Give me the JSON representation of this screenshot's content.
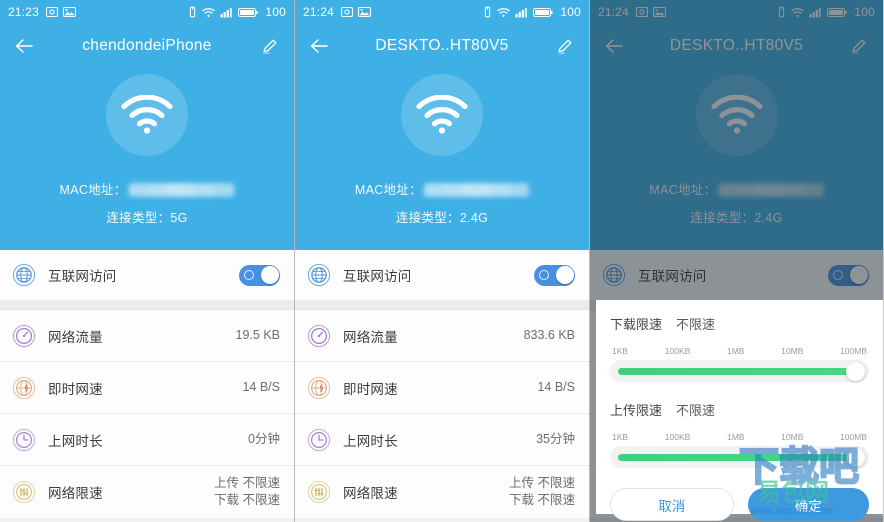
{
  "colors": {
    "accent_blue": "#35a5dd",
    "header_blue_light": "#3fb0e5",
    "panel3_dim": "#2b5063",
    "toggle_on": "#4a90e2",
    "slider_green": "#3fd07e",
    "ok_button": "#3d9ae0",
    "cancel_text": "#3f96e8"
  },
  "panels": [
    {
      "id": "panel-iphone",
      "statusbar": {
        "time": "21:23",
        "left_icons": [
          "screenshot-icon",
          "gallery-icon"
        ],
        "right_icons": [
          "vibrate-icon",
          "wifi-icon",
          "signal-icon",
          "battery-icon"
        ],
        "battery_text": "100"
      },
      "appbar": {
        "back_icon": "arrow-left-icon",
        "title": "chendondeiPhone",
        "edit_icon": "pencil-icon"
      },
      "hero": {
        "wifi_icon": "wifi-icon",
        "mac_label": "MAC地址：",
        "mac_value": "6c:21:A4:3c:40:14",
        "mac_redacted": true,
        "conn_label": "连接类型：",
        "conn_value": "5G"
      },
      "toggle_row": {
        "icon": "globe-icon",
        "label": "互联网访问",
        "state": "on"
      },
      "rows": [
        {
          "icon": "gauge-icon",
          "label": "网络流量",
          "value": "19.5 KB"
        },
        {
          "icon": "speed-icon",
          "label": "即时网速",
          "value": "14 B/S"
        },
        {
          "icon": "clock-icon",
          "label": "上网时长",
          "value": "0分钟"
        },
        {
          "icon": "limit-icon",
          "label": "网络限速",
          "value": "上传 不限速\n下载 不限速"
        }
      ]
    },
    {
      "id": "panel-desktop",
      "statusbar": {
        "time": "21:24",
        "left_icons": [
          "screenshot-icon",
          "gallery-icon"
        ],
        "right_icons": [
          "vibrate-icon",
          "wifi-icon",
          "signal-icon",
          "battery-icon"
        ],
        "battery_text": "100"
      },
      "appbar": {
        "back_icon": "arrow-left-icon",
        "title": "DESKTO..HT80V5",
        "edit_icon": "pencil-icon"
      },
      "hero": {
        "wifi_icon": "wifi-icon",
        "mac_label": "MAC地址：",
        "mac_value": "a8:5e:45:2b:99:c1",
        "mac_redacted": true,
        "conn_label": "连接类型：",
        "conn_value": "2.4G"
      },
      "toggle_row": {
        "icon": "globe-icon",
        "label": "互联网访问",
        "state": "on"
      },
      "rows": [
        {
          "icon": "gauge-icon",
          "label": "网络流量",
          "value": "833.6 KB"
        },
        {
          "icon": "speed-icon",
          "label": "即时网速",
          "value": "14 B/S"
        },
        {
          "icon": "clock-icon",
          "label": "上网时长",
          "value": "35分钟"
        },
        {
          "icon": "limit-icon",
          "label": "网络限速",
          "value": "上传 不限速\n下载 不限速"
        }
      ]
    },
    {
      "id": "panel-dialog",
      "dimmed": true,
      "statusbar": {
        "time": "21:24",
        "left_icons": [
          "screenshot-icon",
          "gallery-icon"
        ],
        "right_icons": [
          "vibrate-icon",
          "wifi-icon",
          "signal-icon",
          "battery-icon"
        ],
        "battery_text": "100"
      },
      "appbar": {
        "back_icon": "arrow-left-icon",
        "title": "DESKTO..HT80V5",
        "edit_icon": "pencil-icon"
      },
      "hero": {
        "wifi_icon": "wifi-icon",
        "mac_label": "MAC地址：",
        "mac_value": "a8:5e:45:2b:99:c1",
        "mac_redacted": true,
        "conn_label": "连接类型：",
        "conn_value": "2.4G"
      },
      "toggle_row": {
        "icon": "globe-icon",
        "label": "互联网访问",
        "state": "on"
      },
      "dialog": {
        "download": {
          "label": "下载限速",
          "value": "不限速",
          "ticks": [
            "1KB",
            "100KB",
            "1MB",
            "10MB",
            "100MB"
          ],
          "position_percent": 100
        },
        "upload": {
          "label": "上传限速",
          "value": "不限速",
          "ticks": [
            "1KB",
            "100KB",
            "1MB",
            "10MB",
            "100MB"
          ],
          "position_percent": 100
        },
        "cancel_label": "取消",
        "confirm_label": "确定"
      }
    }
  ],
  "watermark": {
    "title": "下载吧",
    "sub": "易包网",
    "url": "www.xiazaiba.com"
  }
}
